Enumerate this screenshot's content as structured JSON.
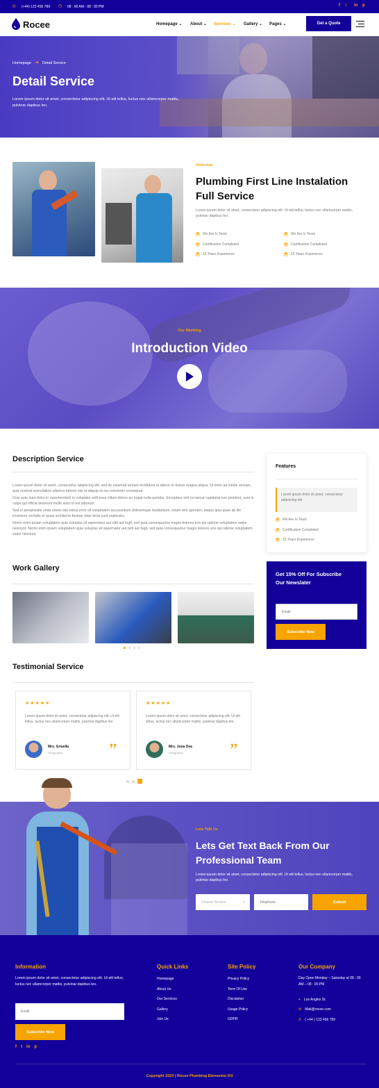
{
  "topbar": {
    "phone": "(+44) 123 456 789",
    "hours": "08 : 00 AM - 08 : 00 PM"
  },
  "nav": {
    "brand": "Rocee",
    "items": [
      "Homepage",
      "About",
      "Services",
      "Gallery",
      "Pages"
    ],
    "cta": "Get a Quote"
  },
  "hero": {
    "breadcrumb_home": "Homepage",
    "breadcrumb_current": "Detail Service",
    "title": "Detail Service",
    "text": "Lorem ipsum dolor sit amet, consectetur adipiscing elit. Ut elit tellus, luctus nec ullamcorper mattis, pulvinar dapibus leo."
  },
  "overview": {
    "kicker": "Overview",
    "title_line1": "Plumbing First Line Instalation",
    "title_line2": "Full Service",
    "text": "Lorem ipsum dolor sit amet, consectetur adipiscing elit. Ut elit tellus, luctus nec ullamcorper mattis, pulvinar dapibus leo.",
    "list": [
      "We Are Is Team",
      "Certification Completed",
      "15 Years Experience"
    ]
  },
  "video": {
    "kicker": "Our Working",
    "title": "Introduction Video"
  },
  "description": {
    "title": "Description Service",
    "paragraphs": [
      "Lorem ipsum dolor sit amet, consectetur adipiscing elit, sed do eiusmod tempor incididunt ut labore et dolore magna aliqua. Ut enim ad minim veniam, quis nostrud exercitation ullamco laboris nisi ut aliquip ex ea commodo consequat.",
      "Duis aute irure dolor in reprehenderit in voluptate velit esse cillum dolore eu fugiat nulla pariatur. Excepteur sint occaecat cupidatat non proident, sunt in culpa qui officia deserunt mollit anim id est laborum.",
      "Sed ut perspiciatis unde omnis iste natus error sit voluptatem accusantium doloremque laudantium, totam rem aperiam, eaque ipsa quae ab illo inventore veritatis et quasi architecto beatae vitae dicta sunt explicabo.",
      "Nemo enim ipsam voluptatem quia voluptas sit aspernatur aut odit aut fugit, sed quia consequuntur magni dolores eos qui ratione voluptatem sequi nesciunt. Nemo enim ipsam voluptatem quia voluptas sit aspernatur aut odit aut fugit, sed quia consequuntur magni dolores eos qui ratione voluptatem sequi nesciunt."
    ]
  },
  "features": {
    "title": "Features",
    "quote": "Lorem ipsum dolor sit amet, consectetur adipiscing elit.",
    "list": [
      "We Are Is Team",
      "Certification Completed",
      "15 Years Experience"
    ]
  },
  "newsletter": {
    "title_line1": "Get 15% Off For Subscribe",
    "title_line2": "Our Newslater",
    "placeholder": "Email",
    "button": "Subscribe Now"
  },
  "gallery": {
    "title": "Work Gallery"
  },
  "testimonial": {
    "title": "Testimonial Service",
    "stars": "★★★★★",
    "items": [
      {
        "text": "Lorem ipsum dolor sit amet, consectetur adipiscing elit. Ut elit tellus, luctus nec ullamcorper mattis, pulvinar dapibus leo.",
        "name": "Mrs. Grisella",
        "role": "Designation"
      },
      {
        "text": "Lorem ipsum dolor sit amet, consectetur adipiscing elit. Ut elit tellus, luctus nec ullamcorper mattis, pulvinar dapibus leo.",
        "name": "Mrs. Jona Doe",
        "role": "Designation"
      }
    ]
  },
  "contact": {
    "kicker": "Lets Talk Us",
    "title_line1": "Lets Get Text Back From Our",
    "title_line2": "Professional Team",
    "text": "Lorem ipsum dolor sit amet, consectetur adipiscing elit. Ut elit tellus, luctus nec ullamcorper mattis, pulvinar dapibus leo.",
    "select_placeholder": "Choose Service",
    "phone_placeholder": "Telephone",
    "button": "Submit"
  },
  "footer": {
    "info_title": "Information",
    "info_text": "Lorem ipsum dolor sit amet, consectetur adipiscing elit. Ut elit tellus, luctus nec ullamcorper mattis, pulvinar dapibus leo.",
    "email_placeholder": "Email",
    "subscribe": "Subscribe Now",
    "quick_title": "Quick Links",
    "quick": [
      "Homepage",
      "About Us",
      "Our Services",
      "Gallery",
      "Join Us"
    ],
    "policy_title": "Site Policy",
    "policy": [
      "Privacy Policy",
      "Term Of Use",
      "Disclaimer",
      "Usage Policy",
      "GDPR"
    ],
    "company_title": "Our Company",
    "company_hours": "Day Open Monday – Saturday at 08 : 00 AM – 08 : 00 PM",
    "address": "Los Angles St.",
    "email": "Mail@rocee.com",
    "phone": "( +44 ) 123 456 789",
    "copyright": "Copyright 2022 | Rocee Plumbing Elementor Kit"
  },
  "colors": {
    "primary": "#13009a",
    "accent": "#f7a400"
  }
}
